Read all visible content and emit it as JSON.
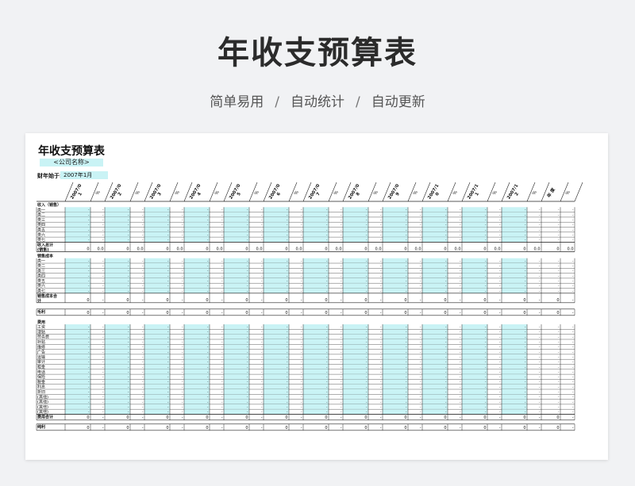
{
  "page": {
    "title": "年收支预算表",
    "subtitle": [
      "简单易用",
      "自动统计",
      "自动更新"
    ],
    "subtitle_sep": "/"
  },
  "sheet": {
    "title": "年收支预算表",
    "company_placeholder": "<公司名称>",
    "fiscal_start_label": "财年始于:",
    "fiscal_start_value": "2007年1月",
    "months": [
      [
        "2007/0",
        "1"
      ],
      [
        "2007/0",
        "2"
      ],
      [
        "2007/0",
        "3"
      ],
      [
        "2007/0",
        "4"
      ],
      [
        "2007/0",
        "5"
      ],
      [
        "2007/0",
        "6"
      ],
      [
        "2007/0",
        "7"
      ],
      [
        "2007/0",
        "8"
      ],
      [
        "2007/0",
        "9"
      ],
      [
        "2007/1",
        "0"
      ],
      [
        "2007/1",
        "1"
      ],
      [
        "2007/1",
        "2"
      ]
    ],
    "pct_header": "%",
    "year_header": "年 度",
    "sections": [
      {
        "header": "收入（销售）",
        "items": [
          "类一",
          "类二",
          "类三",
          "类四",
          "类五",
          "类六",
          "类七"
        ],
        "total_lines": [
          "收入总计",
          "(销售)"
        ],
        "total_value": "0",
        "total_pct": "0.0"
      },
      {
        "header": "销售成本",
        "items": [
          "类一",
          "类二",
          "类三",
          "类四",
          "类五",
          "类六",
          "类七"
        ],
        "total_lines": [
          "销售成本合",
          "计"
        ],
        "total_value": "0",
        "total_pct": "-"
      },
      {
        "header": "",
        "items": [],
        "total_lines": [
          "毛利"
        ],
        "total_value": "0",
        "total_pct": "-"
      },
      {
        "header": "费用",
        "items": [
          "工资",
          "津贴",
          "劳务费",
          "补贴",
          "维修",
          "广告",
          "运输",
          "审计",
          "租金",
          "电话",
          "保险",
          "税金",
          "利息",
          "折旧",
          "(其他)",
          "(其他)",
          "(其他)",
          "(其他)"
        ],
        "total_lines": [
          "费用合计"
        ],
        "total_value": "0",
        "total_pct": "-"
      },
      {
        "header": "",
        "items": [],
        "total_lines": [
          "纯利"
        ],
        "total_value": "0",
        "total_pct": "-"
      }
    ],
    "empty_cell": "-",
    "colors": {
      "input_fill": "#c9f3f5",
      "header_text": "#2b2b2b"
    }
  }
}
